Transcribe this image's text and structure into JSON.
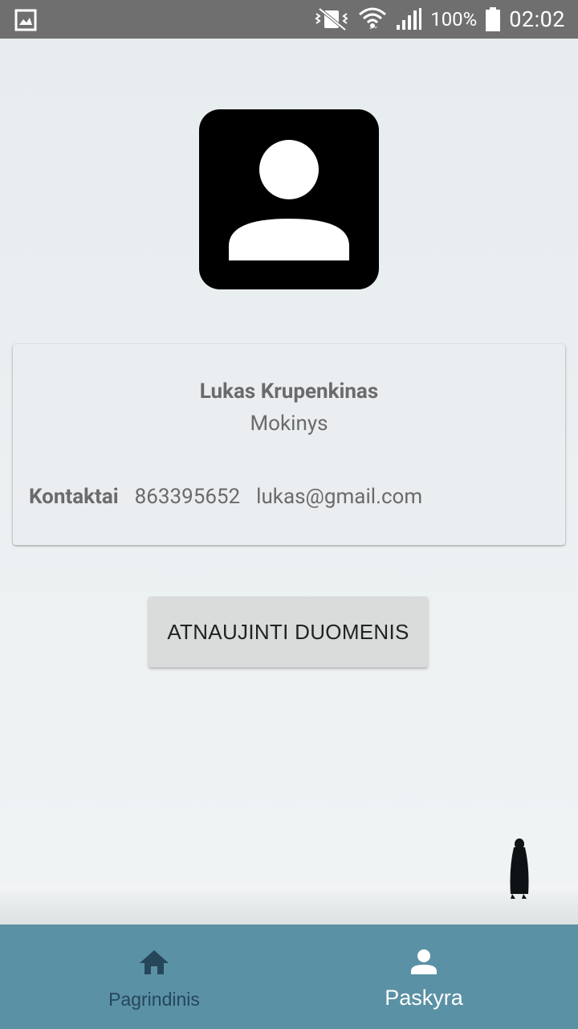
{
  "status_bar": {
    "battery_percent": "100%",
    "time": "02:02",
    "icons": [
      "gallery-icon",
      "vibrate-mute-icon",
      "wifi-icon",
      "signal-icon",
      "battery-icon"
    ]
  },
  "profile": {
    "name": "Lukas Krupenkinas",
    "role": "Mokinys",
    "contacts_label": "Kontaktai",
    "phone": "863395652",
    "email": "lukas@gmail.com"
  },
  "actions": {
    "update_button": "ATNAUJINTI DUOMENIS"
  },
  "bottom_nav": {
    "items": [
      {
        "label": "Pagrindinis",
        "icon": "home-icon",
        "active": false
      },
      {
        "label": "Paskyra",
        "icon": "person-icon",
        "active": true
      }
    ]
  },
  "colors": {
    "nav_background": "#5a91a5",
    "nav_inactive": "#26465a",
    "nav_active": "#ffffff",
    "status_bar": "#6f6f6f"
  }
}
